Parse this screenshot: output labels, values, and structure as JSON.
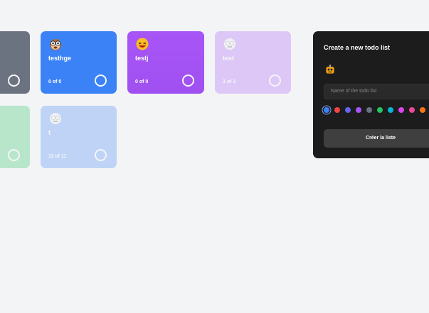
{
  "lists": [
    {
      "title": "",
      "count": "",
      "color": "#6b7280",
      "emoji": "none"
    },
    {
      "title": "testhge",
      "count": "0 of 0",
      "color": "#3b82f6",
      "emoji": "monkey-face"
    },
    {
      "title": "testj",
      "count": "0 of 0",
      "color": "#a855f7",
      "emoji": "laughing-face"
    },
    {
      "title": "test",
      "count": "3 of 3",
      "color": "#a855f7",
      "emoji": "ghost-face"
    },
    {
      "title": "",
      "count": "",
      "color": "#22c55e",
      "emoji": "none"
    },
    {
      "title": "t",
      "count": "11 of 11",
      "color": "#3b82f6",
      "emoji": "ghost-face"
    }
  ],
  "panel": {
    "title": "Create a new todo list",
    "emoji": "robot-face",
    "name_placeholder": "Name of the todo list",
    "colors": [
      "#3b82f6",
      "#ef4444",
      "#6366f1",
      "#a855f7",
      "#6b7280",
      "#22c55e",
      "#06b6d4",
      "#d946ef",
      "#ec4899",
      "#f97316"
    ],
    "selected_color": "#3b82f6",
    "submit_label": "Créer la liste"
  }
}
